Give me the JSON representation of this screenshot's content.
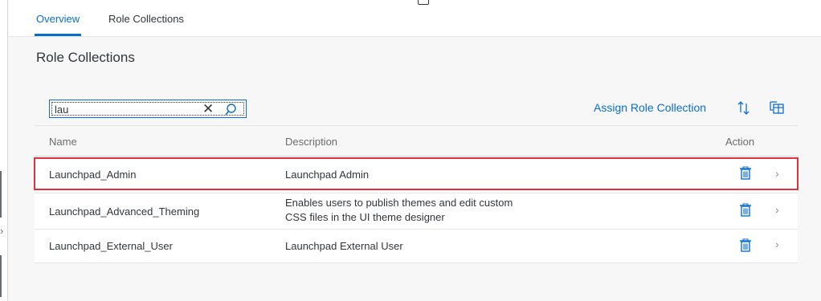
{
  "tabs": [
    {
      "label": "Overview",
      "active": true
    },
    {
      "label": "Role Collections",
      "active": false
    }
  ],
  "section": {
    "title": "Role Collections"
  },
  "search": {
    "value": "lau",
    "clear_glyph": "✕"
  },
  "toolbar": {
    "assign_label": "Assign Role Collection"
  },
  "table": {
    "headers": {
      "name": "Name",
      "description": "Description",
      "action": "Action"
    },
    "rows": [
      {
        "name": "Launchpad_Admin",
        "description": "Launchpad Admin",
        "nav": "›"
      },
      {
        "name": "Launchpad_Advanced_Theming",
        "description": "Enables users to publish themes and edit custom CSS files in the UI theme designer",
        "nav": "›"
      },
      {
        "name": "Launchpad_External_User",
        "description": "Launchpad External User",
        "nav": "›"
      }
    ]
  },
  "rail": {
    "chevron": "›"
  },
  "colors": {
    "accent": "#0a6ed1",
    "highlight": "#e0323a",
    "text": "#32363a",
    "muted": "#6a6d70"
  }
}
